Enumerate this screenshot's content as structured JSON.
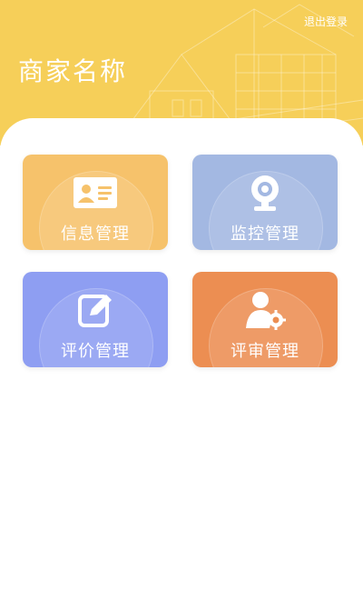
{
  "header": {
    "logout_label": "退出登录",
    "merchant_name": "商家名称"
  },
  "menu": {
    "items": [
      {
        "id": "info",
        "label": "信息管理",
        "icon": "id-card-icon",
        "color": "#f6c26b"
      },
      {
        "id": "monitor",
        "label": "监控管理",
        "icon": "webcam-icon",
        "color": "#a3b8e2"
      },
      {
        "id": "review",
        "label": "评价管理",
        "icon": "edit-icon",
        "color": "#8e9ef2"
      },
      {
        "id": "audit",
        "label": "评审管理",
        "icon": "user-settings-icon",
        "color": "#ec8e52"
      }
    ]
  },
  "theme": {
    "header_color": "#f6cf59"
  }
}
